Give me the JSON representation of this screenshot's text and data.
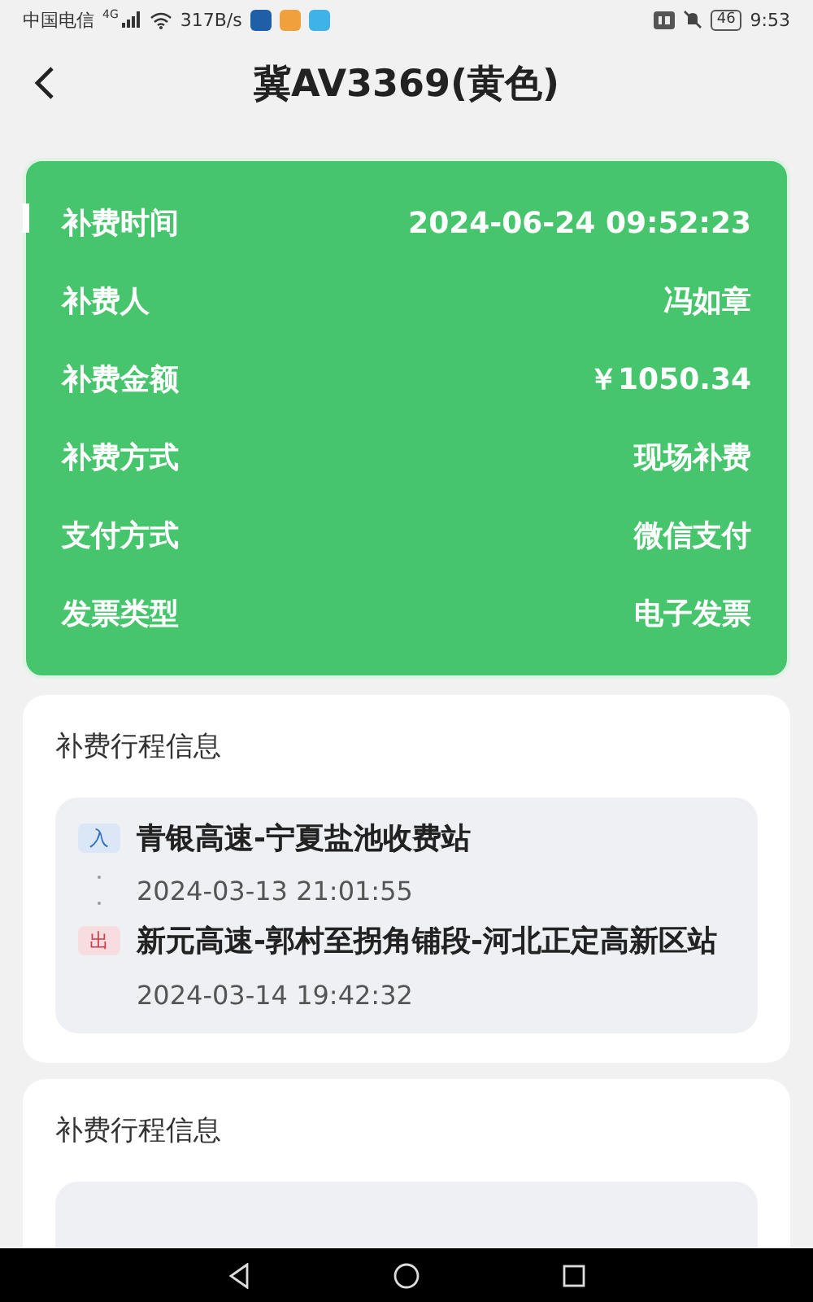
{
  "status_bar": {
    "carrier": "中国电信",
    "network": "4G",
    "speed": "317B/s",
    "battery": "46",
    "time": "9:53"
  },
  "header": {
    "title": "冀AV3369(黄色)"
  },
  "summary": {
    "rows": [
      {
        "label": "补费时间",
        "value": "2024-06-24 09:52:23"
      },
      {
        "label": "补费人",
        "value": "冯如章"
      },
      {
        "label": "补费金额",
        "value": "￥1050.34"
      },
      {
        "label": "补费方式",
        "value": "现场补费"
      },
      {
        "label": "支付方式",
        "value": "微信支付"
      },
      {
        "label": "发票类型",
        "value": "电子发票"
      }
    ]
  },
  "trips": [
    {
      "title": "补费行程信息",
      "stops": [
        {
          "kind": "entry",
          "tag": "入",
          "station": "青银高速-宁夏盐池收费站",
          "time": "2024-03-13 21:01:55"
        },
        {
          "kind": "exit",
          "tag": "出",
          "station": "新元高速-郭村至拐角铺段-河北正定高新区站",
          "time": "2024-03-14 19:42:32"
        }
      ]
    },
    {
      "title": "补费行程信息"
    }
  ]
}
